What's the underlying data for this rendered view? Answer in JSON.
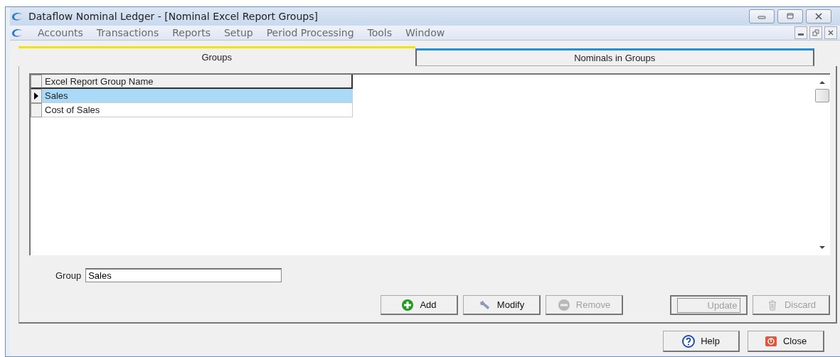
{
  "window": {
    "title": "Dataflow Nominal Ledger - [Nominal Excel Report Groups]"
  },
  "menu": [
    "Accounts",
    "Transactions",
    "Reports",
    "Setup",
    "Period Processing",
    "Tools",
    "Window"
  ],
  "tabs": [
    {
      "label": "Groups",
      "selected": true
    },
    {
      "label": "Nominals in Groups",
      "selected": false
    }
  ],
  "grid": {
    "columns": [
      "Excel Report Group Name"
    ],
    "rows": [
      {
        "cells": [
          "Sales"
        ],
        "selected": true
      },
      {
        "cells": [
          "Cost of Sales"
        ],
        "selected": false
      }
    ]
  },
  "group_field": {
    "label": "Group",
    "value": "Sales"
  },
  "actions": [
    {
      "kind": "add",
      "label": "Add",
      "disabled": false
    },
    {
      "kind": "modify",
      "label": "Modify",
      "disabled": false
    },
    {
      "kind": "remove",
      "label": "Remove",
      "disabled": true
    }
  ],
  "edit_actions": [
    {
      "kind": "update",
      "label": "Update",
      "disabled": true,
      "focused": true
    },
    {
      "kind": "discard",
      "label": "Discard",
      "disabled": true,
      "focused": false
    }
  ],
  "footer_buttons": [
    {
      "kind": "help",
      "label": "Help"
    },
    {
      "kind": "close",
      "label": "Close"
    }
  ]
}
